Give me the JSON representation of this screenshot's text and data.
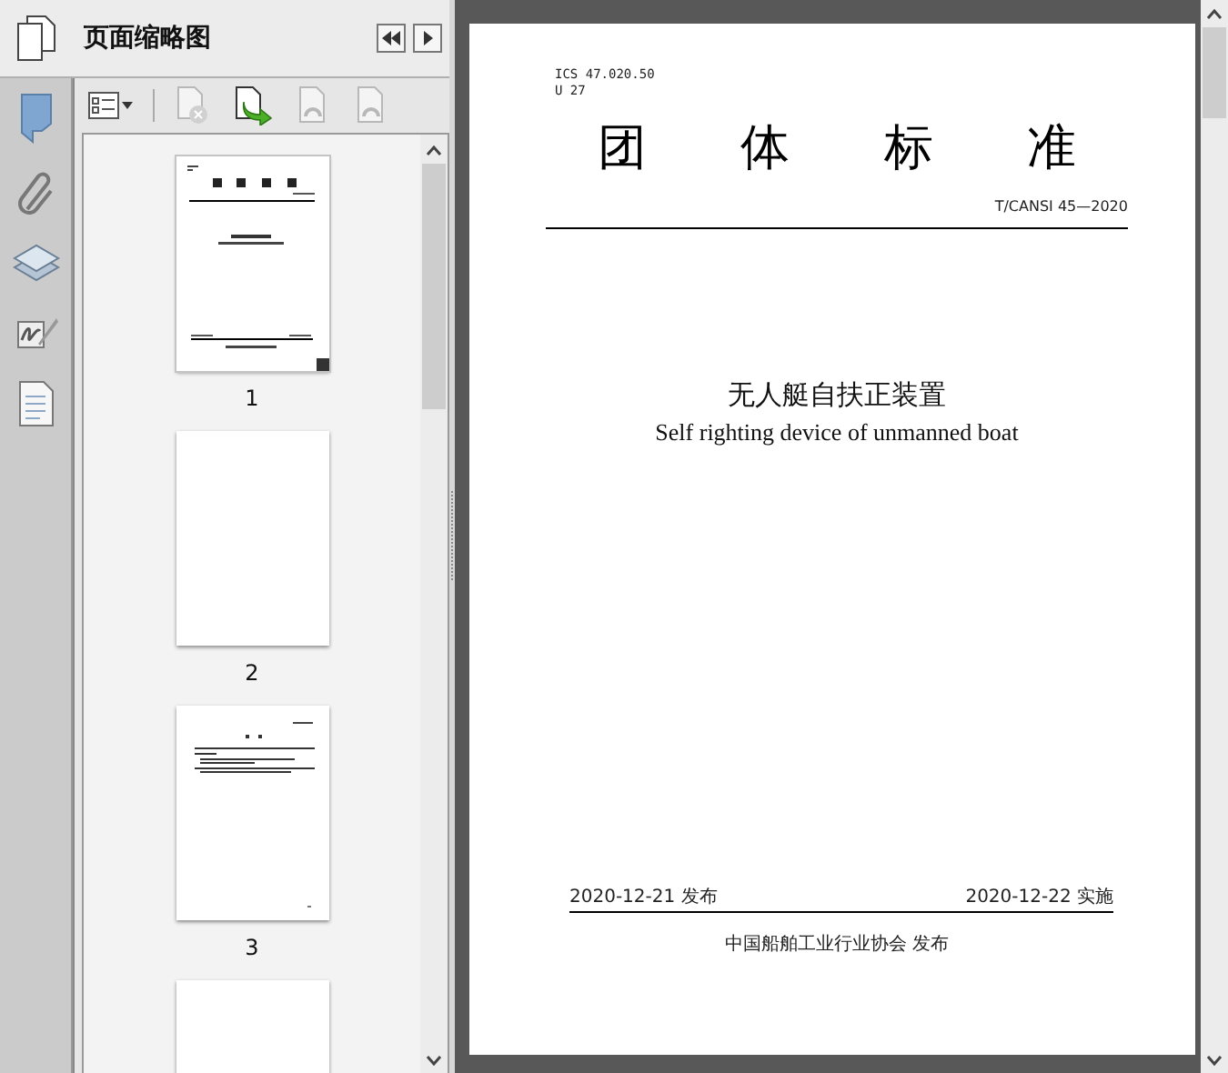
{
  "sidebar": {
    "title": "页面缩略图",
    "toolbar": [
      {
        "kind": "options",
        "disabled": false
      },
      {
        "kind": "delete",
        "disabled": true
      },
      {
        "kind": "insert",
        "disabled": false
      },
      {
        "kind": "rotate-left",
        "disabled": true
      },
      {
        "kind": "rotate-right",
        "disabled": true
      }
    ],
    "thumbnails": [
      {
        "kind": "cover",
        "label": "1",
        "selected": true
      },
      {
        "kind": "blank",
        "label": "2",
        "selected": false
      },
      {
        "kind": "text",
        "label": "3",
        "selected": false
      },
      {
        "kind": "blank",
        "selected": false
      }
    ]
  },
  "document": {
    "codes": [
      "ICS 47.020.50",
      "U 27"
    ],
    "heading": "团 体 标 准",
    "number": "T/CANSI 45—2020",
    "title": "无人艇自扶正装置",
    "subtitle": "Self righting device of unmanned boat",
    "issue_date": "2020-12-21 发布",
    "effective_date": "2020-12-22 实施",
    "publisher": "中国船舶工业行业协会 发布"
  }
}
